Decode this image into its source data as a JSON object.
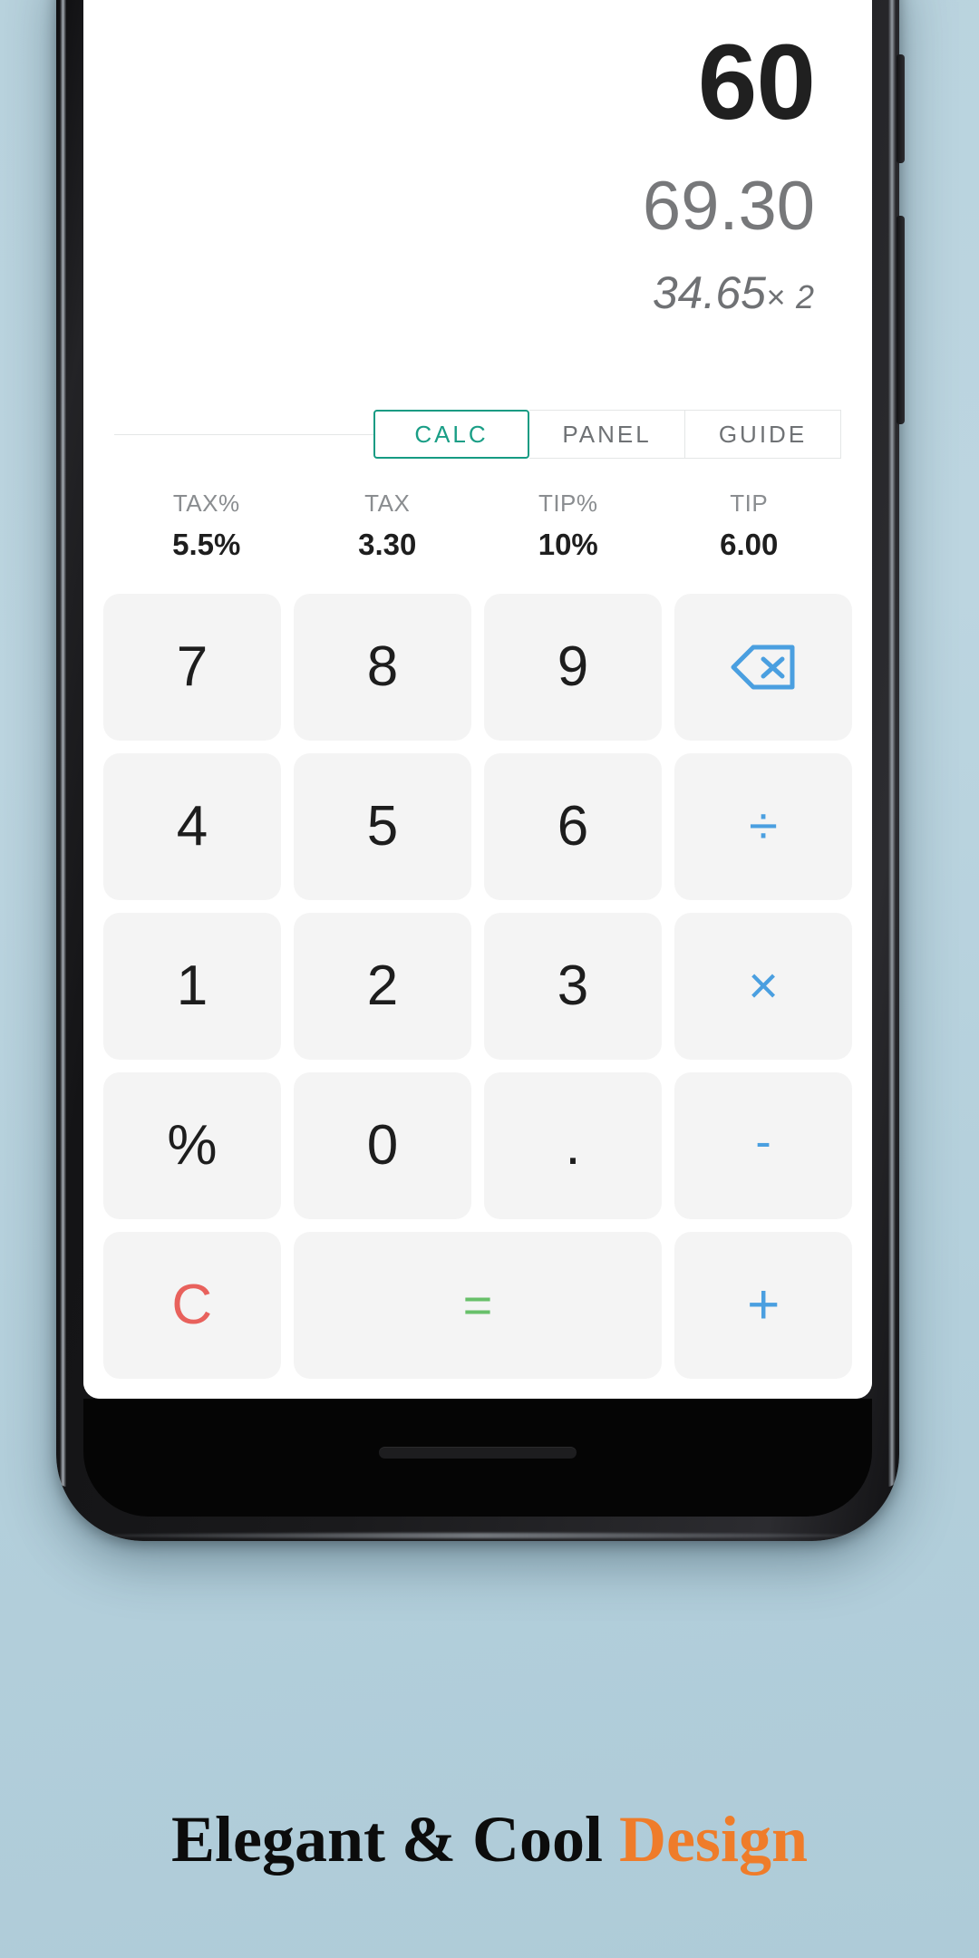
{
  "theme": {
    "background": "#b7d2dd",
    "accent_teal": "#169b83",
    "accent_blue": "#4a9fe0",
    "accent_red": "#e8615c",
    "accent_green": "#68c06a",
    "accent_orange": "#ef7c2a",
    "key_background": "#f4f4f4"
  },
  "display": {
    "main_value": "60",
    "sub_value": "69.30",
    "expression_value": "34.65",
    "expression_operator": "× 2"
  },
  "tabs": [
    {
      "label": "CALC",
      "active": true
    },
    {
      "label": "PANEL",
      "active": false
    },
    {
      "label": "GUIDE",
      "active": false
    }
  ],
  "info": [
    {
      "label": "TAX%",
      "value": "5.5%"
    },
    {
      "label": "TAX",
      "value": "3.30"
    },
    {
      "label": "TIP%",
      "value": "10%"
    },
    {
      "label": "TIP",
      "value": "6.00"
    }
  ],
  "keypad": {
    "row1": [
      {
        "label": "7",
        "kind": "digit",
        "name": "key-7"
      },
      {
        "label": "8",
        "kind": "digit",
        "name": "key-8"
      },
      {
        "label": "9",
        "kind": "digit",
        "name": "key-9"
      },
      {
        "label": "backspace-icon",
        "kind": "icon",
        "name": "key-backspace"
      }
    ],
    "row2": [
      {
        "label": "4",
        "kind": "digit",
        "name": "key-4"
      },
      {
        "label": "5",
        "kind": "digit",
        "name": "key-5"
      },
      {
        "label": "6",
        "kind": "digit",
        "name": "key-6"
      },
      {
        "label": "÷",
        "kind": "op",
        "name": "key-divide"
      }
    ],
    "row3": [
      {
        "label": "1",
        "kind": "digit",
        "name": "key-1"
      },
      {
        "label": "2",
        "kind": "digit",
        "name": "key-2"
      },
      {
        "label": "3",
        "kind": "digit",
        "name": "key-3"
      },
      {
        "label": "×",
        "kind": "op",
        "name": "key-multiply"
      }
    ],
    "row4": [
      {
        "label": "%",
        "kind": "digit",
        "name": "key-percent"
      },
      {
        "label": "0",
        "kind": "digit",
        "name": "key-0"
      },
      {
        "label": ".",
        "kind": "digit",
        "name": "key-decimal"
      },
      {
        "label": "-",
        "kind": "op",
        "name": "key-minus"
      }
    ],
    "row5": [
      {
        "label": "C",
        "kind": "clear",
        "name": "key-clear"
      },
      {
        "label": "=",
        "kind": "equals",
        "name": "key-equals"
      },
      {
        "label": "+",
        "kind": "op",
        "name": "key-plus"
      }
    ]
  },
  "tagline": {
    "text_plain": "Elegant & Cool ",
    "text_accent": "Design"
  }
}
